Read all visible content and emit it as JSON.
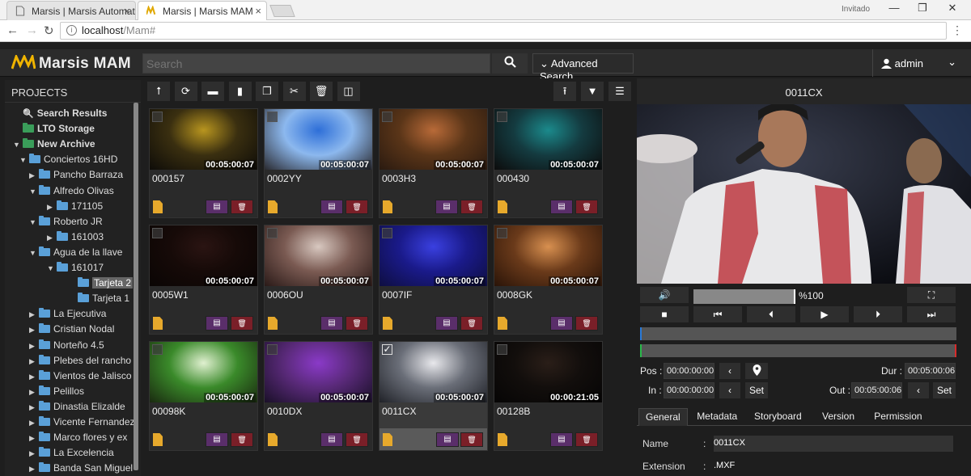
{
  "browser": {
    "tabs": [
      {
        "title": "Marsis | Marsis Automat",
        "close": "×"
      },
      {
        "title": "Marsis | Marsis MAM",
        "close": "×"
      }
    ],
    "guest_label": "Invitado",
    "window": {
      "minimize": "—",
      "maximize": "❐",
      "close": "✕"
    },
    "url_host": "localhost",
    "url_path": "/Mam#"
  },
  "app": {
    "logo_text": "Marsis MAM",
    "search_placeholder": "Search",
    "advanced_search": "Advanced Search",
    "user": "admin"
  },
  "sidebar": {
    "title": "PROJECTS",
    "items": [
      {
        "label": "Search Results",
        "level": 0,
        "bold": true,
        "icon": "search-icon"
      },
      {
        "label": "LTO Storage",
        "level": 0,
        "bold": true,
        "icon": "folder-icon"
      },
      {
        "label": "New Archive",
        "level": 0,
        "bold": true,
        "icon": "folder-icon",
        "expanded": true
      },
      {
        "label": "Conciertos 16HD",
        "level": 1,
        "expanded": true
      },
      {
        "label": "Pancho Barraza",
        "level": 2
      },
      {
        "label": "Alfredo Olivas",
        "level": 2,
        "expanded": true
      },
      {
        "label": "171105",
        "level": 3
      },
      {
        "label": "Roberto JR",
        "level": 2,
        "expanded": true
      },
      {
        "label": "161003",
        "level": 3
      },
      {
        "label": "Agua de la llave",
        "level": 2,
        "expanded": true
      },
      {
        "label": "161017",
        "level": 3,
        "expanded": true
      },
      {
        "label": "Tarjeta 2",
        "level": 4,
        "selected": true
      },
      {
        "label": "Tarjeta 1",
        "level": 4
      },
      {
        "label": "La Ejecutiva",
        "level": 2
      },
      {
        "label": "Cristian Nodal",
        "level": 2
      },
      {
        "label": "Norteño 4.5",
        "level": 2
      },
      {
        "label": "Plebes del rancho",
        "level": 2
      },
      {
        "label": "Vientos de Jalisco",
        "level": 2
      },
      {
        "label": "Pelillos",
        "level": 2
      },
      {
        "label": "Dinastia Elizalde",
        "level": 2
      },
      {
        "label": "Vicente Fernandez",
        "level": 2
      },
      {
        "label": "Marco flores y ex",
        "level": 2
      },
      {
        "label": "La Excelencia",
        "level": 2
      },
      {
        "label": "Banda San Miguel",
        "level": 2
      }
    ]
  },
  "toolbar": {
    "left": [
      "up-arrow-icon",
      "refresh-icon",
      "folder-icon",
      "file-icon",
      "copy-icon",
      "cut-icon",
      "trash-icon",
      "columns-icon"
    ],
    "right": [
      "upload-icon",
      "filter-icon",
      "list-view-icon"
    ]
  },
  "clips": [
    {
      "name": "000157",
      "duration": "00:05:00:07",
      "colors": [
        "#b8951f",
        "#3a2f10",
        "#0e0c08"
      ]
    },
    {
      "name": "0002YY",
      "duration": "00:05:00:07",
      "colors": [
        "#2e6fd8",
        "#8cb8ee",
        "#2a2a30"
      ]
    },
    {
      "name": "0003H3",
      "duration": "00:05:00:07",
      "colors": [
        "#b86a38",
        "#5a3518",
        "#2a1a10"
      ]
    },
    {
      "name": "000430",
      "duration": "00:05:00:07",
      "colors": [
        "#1b8a8c",
        "#143b40",
        "#0c0c0c"
      ]
    },
    {
      "name": "0005W1",
      "duration": "00:05:00:07",
      "colors": [
        "#2a1412",
        "#160a08",
        "#0a0504"
      ]
    },
    {
      "name": "0006OU",
      "duration": "00:05:00:07",
      "colors": [
        "#d8c8c0",
        "#7a5a52",
        "#2a1a18"
      ]
    },
    {
      "name": "0007IF",
      "duration": "00:05:00:07",
      "colors": [
        "#3a40e0",
        "#1a1a8a",
        "#0e0e40"
      ]
    },
    {
      "name": "0008GK",
      "duration": "00:05:00:07",
      "colors": [
        "#d89050",
        "#6a3a1a",
        "#2a1408"
      ]
    },
    {
      "name": "00098K",
      "duration": "00:05:00:07",
      "colors": [
        "#e0f0d0",
        "#3a8a2a",
        "#1a2a10"
      ]
    },
    {
      "name": "0010DX",
      "duration": "00:05:00:07",
      "colors": [
        "#8a3ac8",
        "#5a2a7a",
        "#1a1028"
      ]
    },
    {
      "name": "0011CX",
      "duration": "00:05:00:07",
      "colors": [
        "#e8e8ec",
        "#6a6e78",
        "#202228"
      ],
      "selected": true
    },
    {
      "name": "00128B",
      "duration": "00:00:21:05",
      "colors": [
        "#2a1e18",
        "#120e0c",
        "#060505"
      ]
    }
  ],
  "player": {
    "title": "0011CX",
    "volume": "%100",
    "volume_level": 1.0,
    "pos_label": "Pos :",
    "pos_value": "00:00:00:00",
    "dur_label": "Dur :",
    "dur_value": "00:05:00:06",
    "in_label": "In :",
    "in_value": "00:00:00:00",
    "out_label": "Out :",
    "out_value": "00:05:00:06",
    "set_label": "Set"
  },
  "details": {
    "tabs": [
      "General",
      "Metadata",
      "Storyboard",
      "Version",
      "Permission"
    ],
    "active_tab": "General",
    "name_label": "Name",
    "name_value": "0011CX",
    "ext_label": "Extension",
    "ext_value": ".MXF"
  }
}
